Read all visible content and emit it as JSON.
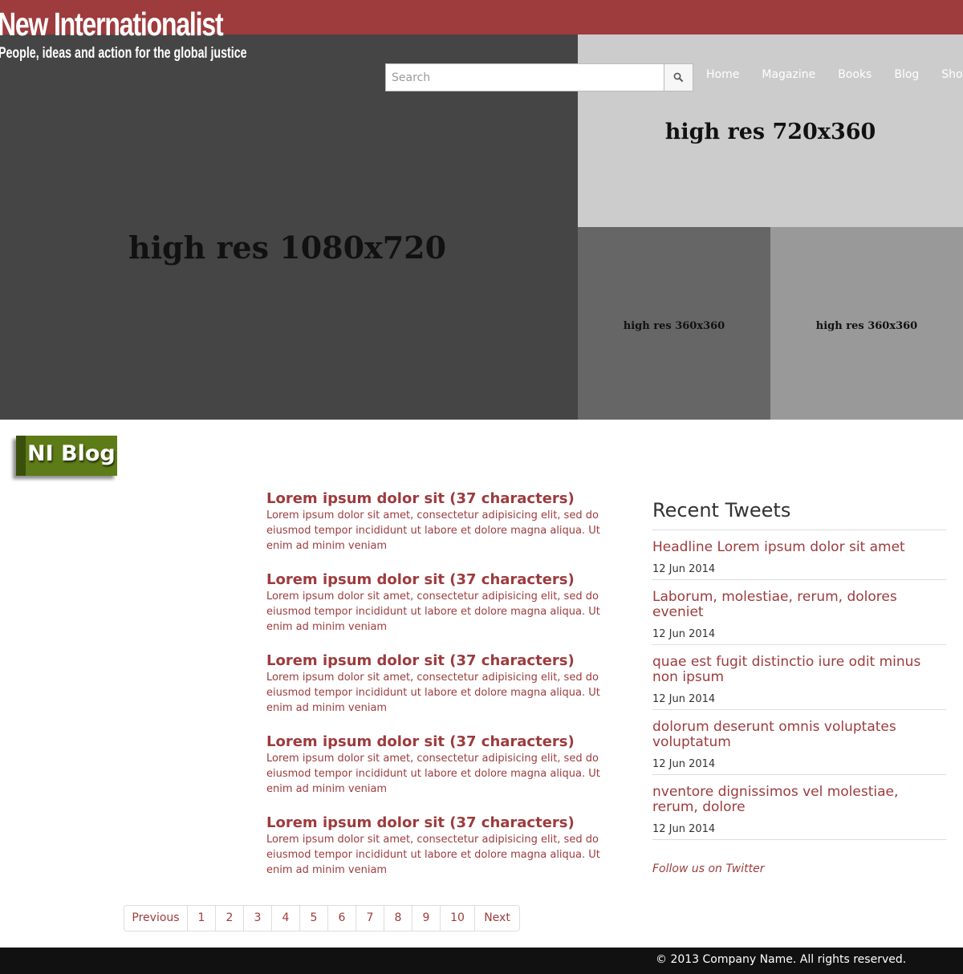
{
  "header": {
    "brand": "New Internationalist",
    "tagline": "People, ideas and action for the global justice",
    "search_placeholder": "Search",
    "nav": [
      "Home",
      "Magazine",
      "Books",
      "Blog",
      "Shop"
    ]
  },
  "hero": {
    "main": "high res 1080x720",
    "top_right": "high res 720x360",
    "small_left": "high res 360x360",
    "small_right": "high res 360x360"
  },
  "blog": {
    "badge": "NI Blog",
    "posts": [
      {
        "title": "Lorem ipsum dolor sit (37 characters)",
        "excerpt": "Lorem ipsum dolor sit amet, consectetur adipisicing elit, sed do eiusmod tempor incididunt ut labore et dolore magna aliqua. Ut enim ad minim veniam"
      },
      {
        "title": "Lorem ipsum dolor sit (37 characters)",
        "excerpt": "Lorem ipsum dolor sit amet, consectetur adipisicing elit, sed do eiusmod tempor incididunt ut labore et dolore magna aliqua. Ut enim ad minim veniam"
      },
      {
        "title": "Lorem ipsum dolor sit (37 characters)",
        "excerpt": "Lorem ipsum dolor sit amet, consectetur adipisicing elit, sed do eiusmod tempor incididunt ut labore et dolore magna aliqua. Ut enim ad minim veniam"
      },
      {
        "title": "Lorem ipsum dolor sit (37 characters)",
        "excerpt": "Lorem ipsum dolor sit amet, consectetur adipisicing elit, sed do eiusmod tempor incididunt ut labore et dolore magna aliqua. Ut enim ad minim veniam"
      },
      {
        "title": "Lorem ipsum dolor sit (37 characters)",
        "excerpt": "Lorem ipsum dolor sit amet, consectetur adipisicing elit, sed do eiusmod tempor incididunt ut labore et dolore magna aliqua. Ut enim ad minim veniam"
      }
    ]
  },
  "tweets": {
    "title": "Recent Tweets",
    "items": [
      {
        "text": "Headline Lorem ipsum dolor sit amet",
        "date": "12 Jun 2014"
      },
      {
        "text": "Laborum, molestiae, rerum, dolores eveniet",
        "date": "12 Jun 2014"
      },
      {
        "text": "quae est fugit distinctio iure odit minus non ipsum",
        "date": "12 Jun 2014"
      },
      {
        "text": "dolorum deserunt omnis voluptates voluptatum",
        "date": "12 Jun 2014"
      },
      {
        "text": "nventore dignissimos vel molestiae, rerum, dolore",
        "date": "12 Jun 2014"
      }
    ],
    "follow": "Follow us on Twitter"
  },
  "pagination": [
    "Previous",
    "1",
    "2",
    "3",
    "4",
    "5",
    "6",
    "7",
    "8",
    "9",
    "10",
    "Next"
  ],
  "footer": {
    "copyright": "© 2013 Company Name. All rights reserved."
  },
  "colors": {
    "brand_red": "#9d3b3d",
    "badge_green": "#5d7b16",
    "footer_bg": "#111111"
  },
  "icons": {
    "search_button": "search-icon"
  }
}
